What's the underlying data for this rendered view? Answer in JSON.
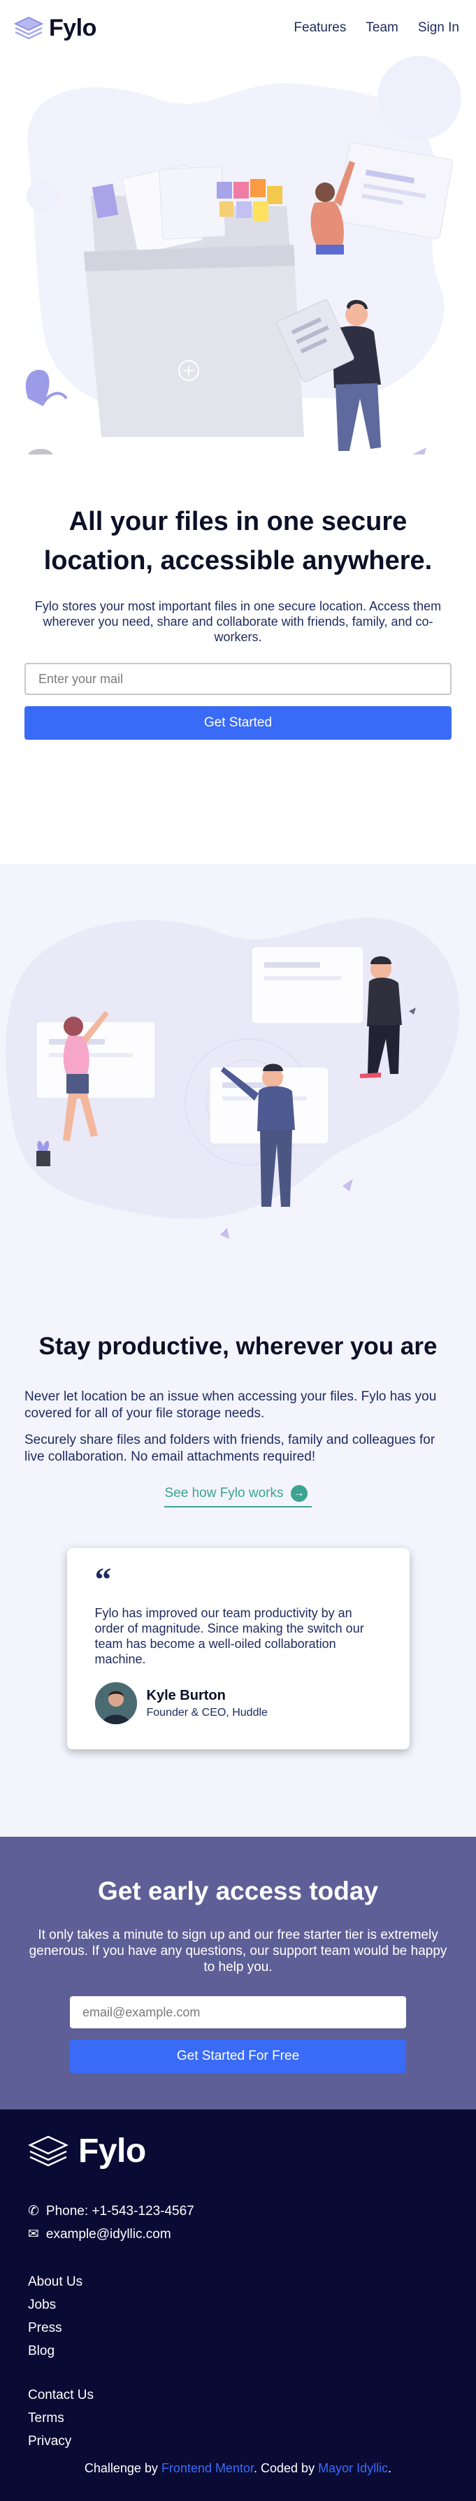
{
  "header": {
    "logo_text": "Fylo",
    "nav": [
      "Features",
      "Team",
      "Sign In"
    ]
  },
  "hero": {
    "title": "All your files in one secure location, accessible anywhere.",
    "text": "Fylo stores your most important files in one secure location. Access them wherever you need, share and collaborate with friends, family, and co-workers.",
    "email_placeholder": "Enter your mail",
    "button_label": "Get Started"
  },
  "productive": {
    "title": "Stay productive, wherever you are",
    "paragraph_1": "Never let location be an issue when accessing your files. Fylo has you covered for all of your file storage needs.",
    "paragraph_2": "Securely share files and folders with friends, family and colleagues for live collaboration. No email attachments required!",
    "link_label": "See how Fylo works"
  },
  "testimonial": {
    "quote": "Fylo has improved our team productivity by an order of magnitude. Since making the switch our team has become a well-oiled collaboration machine.",
    "name": "Kyle Burton",
    "role": "Founder & CEO, Huddle"
  },
  "cta": {
    "title": "Get early access today",
    "text": "It only takes a minute to sign up and our free starter tier is extremely generous. If you have any questions, our support team would be happy to help you.",
    "email_placeholder": "email@example.com",
    "button_label": "Get Started For Free"
  },
  "footer": {
    "logo_text": "Fylo",
    "phone": "Phone: +1-543-123-4567",
    "email": "example@idyllic.com",
    "links_1": [
      "About Us",
      "Jobs",
      "Press",
      "Blog"
    ],
    "links_2": [
      "Contact Us",
      "Terms",
      "Privacy"
    ],
    "attribution": {
      "prefix": "Challenge by",
      "frontend_mentor": "Frontend Mentor",
      "middle": ". Coded by",
      "coder": "Mayor Idyllic",
      "suffix": "."
    }
  },
  "colors": {
    "accent": "#3a6bf7",
    "teal": "#3aa392",
    "cta_bg": "#5f5f97",
    "footer_bg": "#0a0b34",
    "section_bg": "#f4f4fd"
  }
}
